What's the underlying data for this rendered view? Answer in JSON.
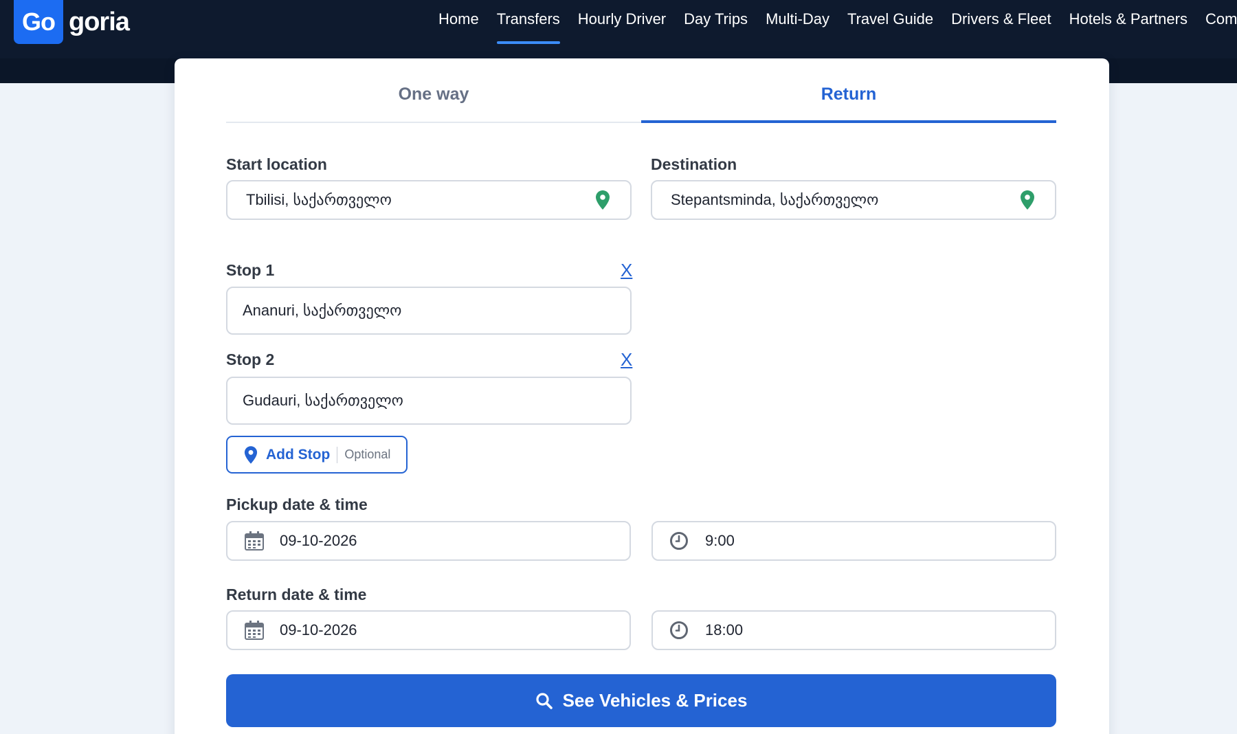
{
  "brand": {
    "logo_box": "Go",
    "logo_text": "goria"
  },
  "nav": {
    "items": [
      {
        "label": "Home"
      },
      {
        "label": "Transfers",
        "active": true
      },
      {
        "label": "Hourly Driver"
      },
      {
        "label": "Day Trips"
      },
      {
        "label": "Multi-Day"
      },
      {
        "label": "Travel Guide"
      },
      {
        "label": "Drivers & Fleet"
      },
      {
        "label": "Hotels & Partners"
      },
      {
        "label": "Comp"
      }
    ]
  },
  "form": {
    "tabs": [
      {
        "label": "One way",
        "active": false
      },
      {
        "label": "Return",
        "active": true
      }
    ],
    "start": {
      "label": "Start location",
      "value": "Tbilisi, საქართველო"
    },
    "destination": {
      "label": "Destination",
      "value": "Stepantsminda, საქართველო"
    },
    "stops": [
      {
        "label": "Stop 1",
        "value": "Ananuri, საქართველო",
        "remove": "X"
      },
      {
        "label": "Stop 2",
        "value": "Gudauri, საქართველო",
        "remove": "X"
      }
    ],
    "add_stop": {
      "label": "Add Stop",
      "optional": "Optional"
    },
    "pickup": {
      "label": "Pickup date & time",
      "date": "09-10-2026",
      "time": "9:00"
    },
    "return": {
      "label": "Return date & time",
      "date": "09-10-2026",
      "time": "18:00"
    },
    "submit": "See Vehicles & Prices"
  },
  "colors": {
    "nav_bg": "#0e1a2e",
    "accent": "#2463d3",
    "logo_blue": "#1c6cf2",
    "pin_green": "#2e9e6a"
  },
  "icons": [
    "map-pin-icon",
    "calendar-icon",
    "clock-icon",
    "search-icon"
  ]
}
